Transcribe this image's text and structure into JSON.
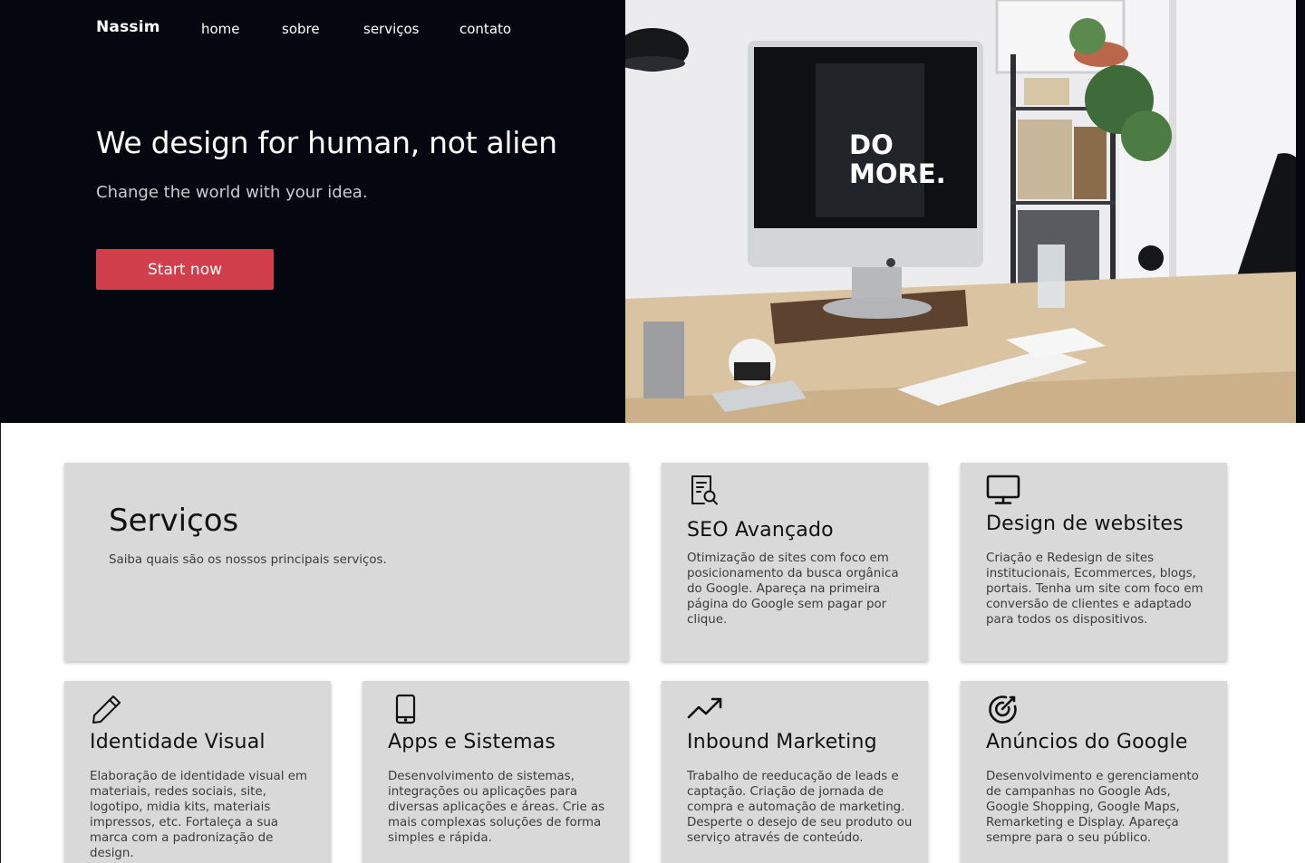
{
  "brand": "Nassim",
  "nav": [
    "home",
    "sobre",
    "serviços",
    "contato"
  ],
  "hero": {
    "title": "We design for human, not alien",
    "subtitle": "Change the world with your idea.",
    "cta_label": "Start now",
    "image_text": [
      "DO",
      "MORE."
    ]
  },
  "services_intro": {
    "title": "Serviços",
    "subtitle": "Saiba quais são os nossos principais serviços."
  },
  "services": [
    {
      "icon": "seo-document-search-icon",
      "title": "SEO Avançado",
      "text": "Otimização de sites com foco em posicionamento da busca orgânica do Google. Apareça na primeira página do Google sem pagar por clique."
    },
    {
      "icon": "monitor-icon",
      "title": "Design de websites",
      "text": "Criação e Redesign de sites institucionais, Ecommerces, blogs, portais. Tenha um site com foco em conversão de clientes e adaptado para todos os dispositivos."
    },
    {
      "icon": "pencil-icon",
      "title": "Identidade Visual",
      "text": "Elaboração de identidade visual em materiais, redes sociais, site, logotipo, midia kits, materiais impressos, etc. Fortaleça a sua marca com a padronização de design."
    },
    {
      "icon": "smartphone-icon",
      "title": "Apps e Sistemas",
      "text": "Desenvolvimento de sistemas, integrações ou aplicações para diversas aplicações e áreas. Crie as mais complexas soluções de forma simples e rápida."
    },
    {
      "icon": "trending-up-icon",
      "title": "Inbound Marketing",
      "text": "Trabalho de reeducação de leads e captação. Criação de jornada de compra e automação de marketing. Desperte o desejo de seu produto ou serviço através de conteúdo."
    },
    {
      "icon": "target-icon",
      "title": "Anúncios do Google",
      "text": "Desenvolvimento e gerenciamento de campanhas no Google Ads, Google Shopping, Google Maps, Remarketing e Display. Apareça sempre para o seu público."
    }
  ],
  "colors": {
    "hero_bg": "#04070f",
    "cta": "#d23f4c",
    "card_bg": "#d9d9d9"
  }
}
